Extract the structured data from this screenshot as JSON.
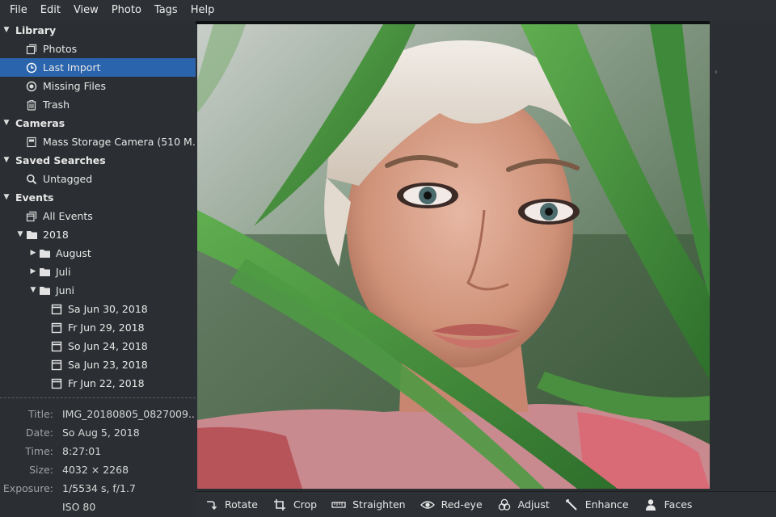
{
  "menubar": [
    "File",
    "Edit",
    "View",
    "Photo",
    "Tags",
    "Help"
  ],
  "sidebar": [
    {
      "id": "library",
      "label": "Library",
      "depth": 0,
      "kind": "section",
      "expanded": true
    },
    {
      "id": "photos",
      "label": "Photos",
      "depth": 1,
      "icon": "photos-icon"
    },
    {
      "id": "last-import",
      "label": "Last Import",
      "depth": 1,
      "icon": "clock-icon",
      "selected": true
    },
    {
      "id": "missing-files",
      "label": "Missing Files",
      "depth": 1,
      "icon": "missing-icon"
    },
    {
      "id": "trash",
      "label": "Trash",
      "depth": 1,
      "icon": "trash-icon"
    },
    {
      "id": "cameras",
      "label": "Cameras",
      "depth": 0,
      "kind": "section",
      "expanded": true
    },
    {
      "id": "mass-storage-camera",
      "label": "Mass Storage Camera (510 M...",
      "depth": 1,
      "icon": "camera-icon"
    },
    {
      "id": "saved-searches",
      "label": "Saved Searches",
      "depth": 0,
      "kind": "section",
      "expanded": true
    },
    {
      "id": "untagged",
      "label": "Untagged",
      "depth": 1,
      "icon": "search-icon"
    },
    {
      "id": "events",
      "label": "Events",
      "depth": 0,
      "kind": "section",
      "expanded": true
    },
    {
      "id": "all-events",
      "label": "All Events",
      "depth": 1,
      "icon": "events-icon"
    },
    {
      "id": "2018",
      "label": "2018",
      "depth": 1,
      "icon": "folder-icon",
      "expandable": true,
      "expanded": true
    },
    {
      "id": "august",
      "label": "August",
      "depth": 2,
      "icon": "folder-icon",
      "expandable": true,
      "expanded": false
    },
    {
      "id": "juli",
      "label": "Juli",
      "depth": 2,
      "icon": "folder-icon",
      "expandable": true,
      "expanded": false
    },
    {
      "id": "juni",
      "label": "Juni",
      "depth": 2,
      "icon": "folder-icon",
      "expandable": true,
      "expanded": true
    },
    {
      "id": "sa-jun-30",
      "label": "Sa Jun 30, 2018",
      "depth": 3,
      "icon": "event-icon"
    },
    {
      "id": "fr-jun-29",
      "label": "Fr Jun 29, 2018",
      "depth": 3,
      "icon": "event-icon"
    },
    {
      "id": "so-jun-24",
      "label": "So Jun 24, 2018",
      "depth": 3,
      "icon": "event-icon"
    },
    {
      "id": "sa-jun-23",
      "label": "Sa Jun 23, 2018",
      "depth": 3,
      "icon": "event-icon"
    },
    {
      "id": "fr-jun-22",
      "label": "Fr Jun 22, 2018",
      "depth": 3,
      "icon": "event-icon"
    }
  ],
  "info": [
    {
      "key": "Title:",
      "value": "IMG_20180805_0827009..."
    },
    {
      "key": "Date:",
      "value": "So Aug 5, 2018"
    },
    {
      "key": "Time:",
      "value": "8:27:01"
    },
    {
      "key": "Size:",
      "value": "4032 × 2268"
    },
    {
      "key": "Exposure:",
      "value": "1/5534 s, f/1.7"
    },
    {
      "key": "",
      "value": "ISO 80"
    }
  ],
  "toolbar": [
    {
      "id": "rotate",
      "label": "Rotate",
      "icon": "rotate-icon"
    },
    {
      "id": "crop",
      "label": "Crop",
      "icon": "crop-icon"
    },
    {
      "id": "straighten",
      "label": "Straighten",
      "icon": "straighten-icon"
    },
    {
      "id": "red-eye",
      "label": "Red-eye",
      "icon": "eye-icon"
    },
    {
      "id": "adjust",
      "label": "Adjust",
      "icon": "adjust-icon"
    },
    {
      "id": "enhance",
      "label": "Enhance",
      "icon": "wand-icon"
    },
    {
      "id": "faces",
      "label": "Faces",
      "icon": "person-icon"
    }
  ],
  "colors": {
    "selection": "#2a64ad",
    "background": "#2b2e32",
    "leaf_green": "#3f8a3a"
  }
}
